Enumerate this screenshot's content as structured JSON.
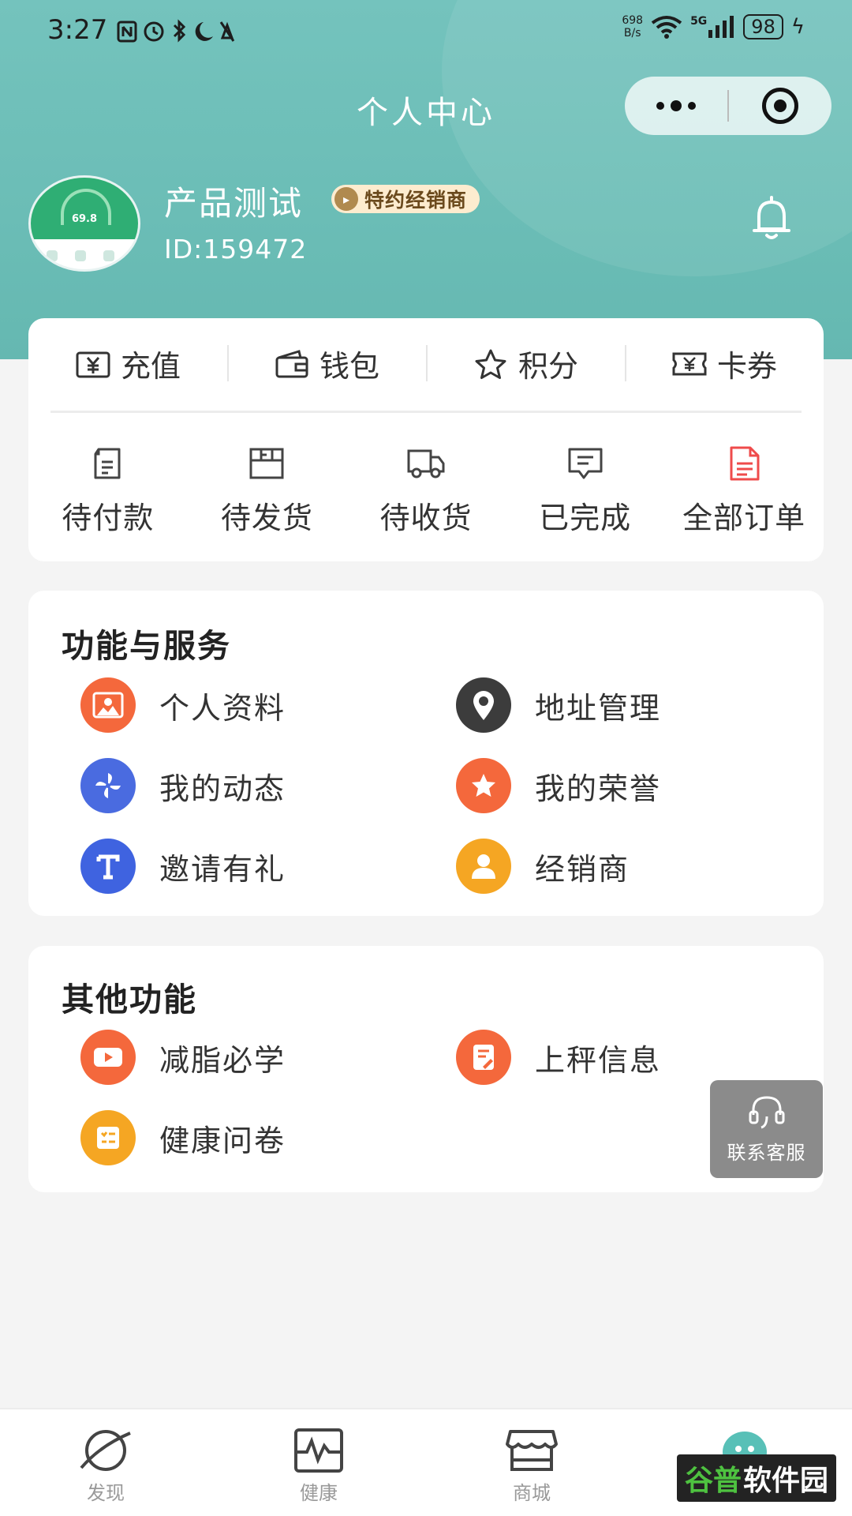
{
  "status_bar": {
    "time": "3:27",
    "net_speed_value": "698",
    "net_speed_unit": "B/s",
    "network": "5G",
    "battery": "98"
  },
  "title_bar": {
    "title": "个人中心"
  },
  "profile": {
    "name": "产品测试",
    "badge": "特约经销商",
    "id_text": "ID:159472",
    "avatar_reading": "69.8"
  },
  "wallet": [
    {
      "label": "充值",
      "icon": "yuan-icon"
    },
    {
      "label": "钱包",
      "icon": "wallet-icon"
    },
    {
      "label": "积分",
      "icon": "star-icon"
    },
    {
      "label": "卡券",
      "icon": "coupon-icon"
    }
  ],
  "orders": [
    {
      "label": "待付款",
      "icon": "pending-payment-icon"
    },
    {
      "label": "待发货",
      "icon": "pending-shipment-icon"
    },
    {
      "label": "待收货",
      "icon": "truck-icon"
    },
    {
      "label": "已完成",
      "icon": "completed-icon"
    },
    {
      "label": "全部订单",
      "icon": "all-orders-icon"
    }
  ],
  "services": {
    "title": "功能与服务",
    "items": [
      {
        "label": "个人资料",
        "icon": "profile-icon",
        "color": "#f4683c"
      },
      {
        "label": "地址管理",
        "icon": "location-icon",
        "color": "#3c3c3c"
      },
      {
        "label": "我的动态",
        "icon": "pinwheel-icon",
        "color": "#4a6be0"
      },
      {
        "label": "我的荣誉",
        "icon": "honor-star-icon",
        "color": "#f4683c"
      },
      {
        "label": "邀请有礼",
        "icon": "invite-icon",
        "color": "#3f63e0"
      },
      {
        "label": "经销商",
        "icon": "dealer-icon",
        "color": "#f5a623"
      }
    ]
  },
  "other": {
    "title": "其他功能",
    "items": [
      {
        "label": "减脂必学",
        "icon": "video-icon",
        "color": "#f4683c"
      },
      {
        "label": "上秤信息",
        "icon": "scale-info-icon",
        "color": "#f4683c"
      },
      {
        "label": "健康问卷",
        "icon": "questionnaire-icon",
        "color": "#f5a623"
      }
    ]
  },
  "contact": {
    "label": "联系客服"
  },
  "bottom_nav": [
    {
      "label": "发现",
      "icon": "planet-icon"
    },
    {
      "label": "健康",
      "icon": "health-chart-icon"
    },
    {
      "label": "商城",
      "icon": "store-icon"
    },
    {
      "label": "",
      "icon": "avatar-bot-icon"
    }
  ],
  "watermark": {
    "part1": "谷普",
    "part2": "软件园"
  },
  "colors": {
    "header": "#6bbdb6",
    "accent_orange": "#f4683c",
    "accent_blue": "#3f63e0",
    "accent_yellow": "#f5a623",
    "red_doc": "#ef4b4b"
  }
}
